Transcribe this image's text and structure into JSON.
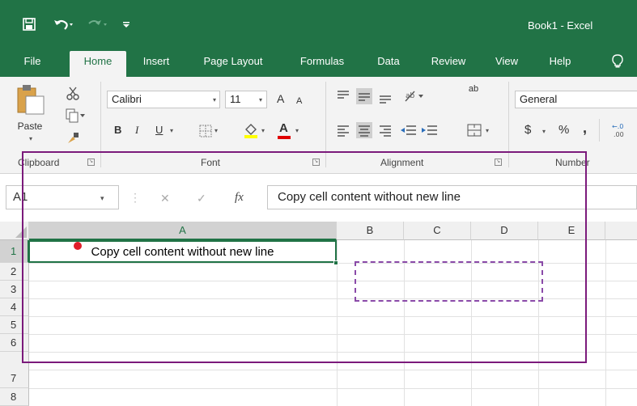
{
  "window": {
    "title": "Book1  -  Excel"
  },
  "quick_access": {
    "save_icon": "save-icon",
    "undo_icon": "undo-icon",
    "redo_icon": "redo-icon",
    "customize_icon": "customize-qat-icon"
  },
  "tabs": [
    {
      "label": "File"
    },
    {
      "label": "Home",
      "active": true
    },
    {
      "label": "Insert"
    },
    {
      "label": "Page Layout"
    },
    {
      "label": "Formulas"
    },
    {
      "label": "Data"
    },
    {
      "label": "Review"
    },
    {
      "label": "View"
    },
    {
      "label": "Help"
    }
  ],
  "ribbon": {
    "clipboard": {
      "group_label": "Clipboard",
      "paste_label": "Paste"
    },
    "font": {
      "group_label": "Font",
      "font_name": "Calibri",
      "font_size": "11",
      "bold": "B",
      "italic": "I",
      "underline": "U",
      "font_color_glyph": "A",
      "grow": "A",
      "shrink": "A"
    },
    "alignment": {
      "group_label": "Alignment",
      "wrap_glyph": "ab"
    },
    "number": {
      "group_label": "Number",
      "format": "General",
      "currency": "$",
      "percent": "%",
      "comma": ",",
      "increase_decimal": "←.0\n.00"
    }
  },
  "formula_bar": {
    "name_box": "A1",
    "cancel": "✕",
    "enter": "✓",
    "fx": "fx",
    "content": "Copy cell content without new line"
  },
  "grid": {
    "columns": [
      "A",
      "B",
      "C",
      "D",
      "E"
    ],
    "rows": [
      "1",
      "2",
      "3",
      "4",
      "5",
      "6",
      "7",
      "8"
    ],
    "cells": {
      "A1": "Copy cell content without new line"
    },
    "selected_cell": "A1"
  },
  "colors": {
    "brand": "#217346",
    "annotation_rect": "#7b1a7b",
    "annotation_dashed": "#8a4aa8",
    "annotation_dot": "#e01e2a"
  }
}
